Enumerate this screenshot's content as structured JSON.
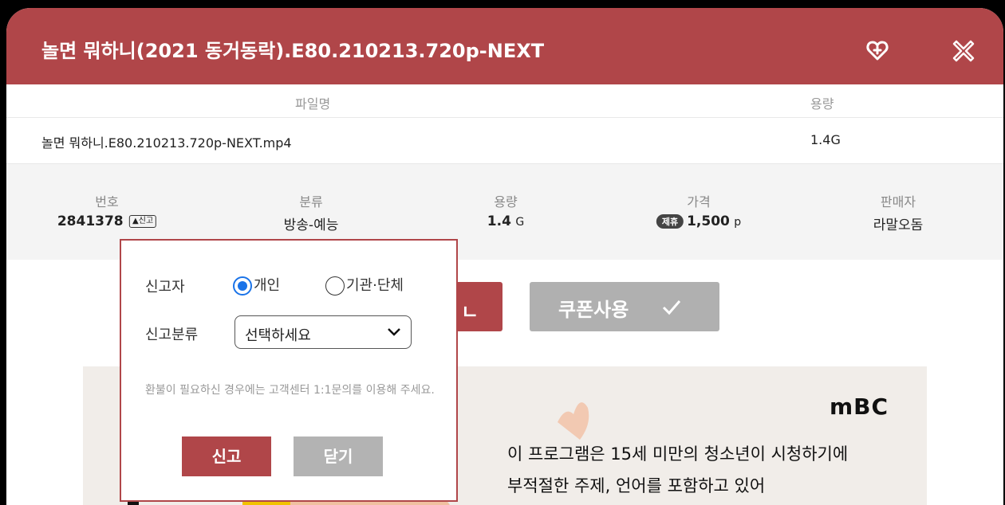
{
  "header": {
    "title": "놀면 뭐하니(2021 동거동락).E80.210213.720p-NEXT",
    "favorite_icon": "heart-plus-icon",
    "close_icon": "close-x-icon"
  },
  "file_table": {
    "col_name": "파일명",
    "col_size": "용량",
    "rows": [
      {
        "name": "놀면 뭐하니.E80.210213.720p-NEXT.mp4",
        "size": "1.4G"
      }
    ]
  },
  "info": {
    "number_label": "번호",
    "number": "2841378",
    "report_tag": "신고",
    "category_label": "분류",
    "category": "방송-예능",
    "size_label": "용량",
    "size_value": "1.4",
    "size_unit": "G",
    "price_label": "가격",
    "price_badge": "제휴",
    "price_value": "1,500",
    "price_unit": "p",
    "seller_label": "판매자",
    "seller": "라말오돔"
  },
  "buttons": {
    "download_partial": "ㄴ",
    "coupon": "쿠폰사용"
  },
  "banner": {
    "logo": "mBC",
    "line1": "이 프로그램은 15세 미만의 청소년이 시청하기에",
    "line2": "부적절한 주제, 언어를 포함하고 있어"
  },
  "report_popup": {
    "reporter_label": "신고자",
    "option_individual": "개인",
    "option_org": "기관·단체",
    "selected_option": "개인",
    "category_label": "신고분류",
    "select_value": "선택하세요",
    "notice": "환불이 필요하신 경우에는 고객센터 1:1문의를 이용해 주세요.",
    "submit": "신고",
    "close": "닫기"
  },
  "colors": {
    "accent": "#b04649",
    "disabled_button": "#b0b0b0",
    "radio_selected": "#1a73e8"
  }
}
